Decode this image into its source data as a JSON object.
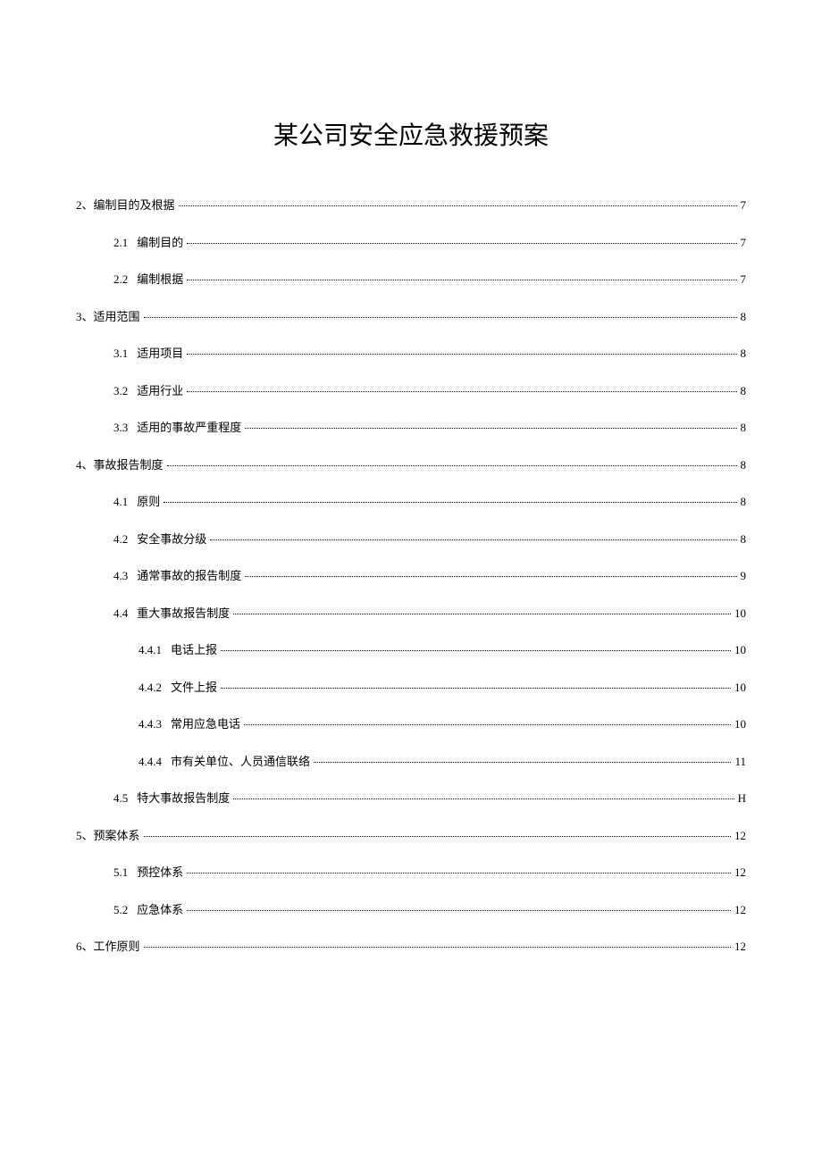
{
  "title": "某公司安全应急救援预案",
  "toc": [
    {
      "level": 1,
      "num": "2、",
      "text": "编制目的及根据",
      "page": "7"
    },
    {
      "level": 2,
      "num": "2.1",
      "text": "编制目的",
      "page": "7"
    },
    {
      "level": 2,
      "num": "2.2",
      "text": "编制根据",
      "page": "7"
    },
    {
      "level": 1,
      "num": "3、",
      "text": "适用范围",
      "page": "8"
    },
    {
      "level": 2,
      "num": "3.1",
      "text": "适用项目",
      "page": "8"
    },
    {
      "level": 2,
      "num": "3.2",
      "text": "适用行业",
      "page": "8"
    },
    {
      "level": 2,
      "num": "3.3",
      "text": "适用的事故严重程度",
      "page": "8"
    },
    {
      "level": 1,
      "num": "4、",
      "text": "事故报告制度",
      "page": "8"
    },
    {
      "level": 2,
      "num": "4.1",
      "text": "原则",
      "page": "8"
    },
    {
      "level": 2,
      "num": "4.2",
      "text": "安全事故分级",
      "page": "8"
    },
    {
      "level": 2,
      "num": "4.3",
      "text": "通常事故的报告制度",
      "page": "9"
    },
    {
      "level": 2,
      "num": "4.4",
      "text": "重大事故报告制度",
      "page": "10"
    },
    {
      "level": 3,
      "num": "4.4.1",
      "text": "电话上报",
      "page": "10"
    },
    {
      "level": 3,
      "num": "4.4.2",
      "text": "文件上报",
      "page": "10"
    },
    {
      "level": 3,
      "num": "4.4.3",
      "text": "常用应急电话",
      "page": "10"
    },
    {
      "level": 3,
      "num": "4.4.4",
      "text": "市有关单位、人员通信联络",
      "page": "11"
    },
    {
      "level": 2,
      "num": "4.5",
      "text": "特大事故报告制度",
      "page": "H"
    },
    {
      "level": 1,
      "num": "5、",
      "text": "预案体系",
      "page": "12"
    },
    {
      "level": 2,
      "num": "5.1",
      "text": "预控体系",
      "page": "12"
    },
    {
      "level": 2,
      "num": "5.2",
      "text": "应急体系",
      "page": "12"
    },
    {
      "level": 1,
      "num": "6、",
      "text": "工作原则",
      "page": "12"
    }
  ]
}
